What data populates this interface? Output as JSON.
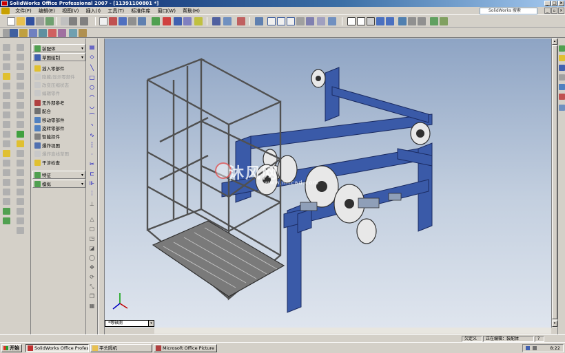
{
  "window": {
    "title": "SolidWorks Office Professional 2007 - [11391100801 *]"
  },
  "menu": {
    "items": [
      "文件(F)",
      "编辑(E)",
      "视图(V)",
      "插入(I)",
      "工具(T)",
      "标准件库",
      "窗口(W)",
      "帮助(H)"
    ],
    "search_label": "SolidWorks 搜索"
  },
  "panel": {
    "items": [
      {
        "label": "装配体",
        "state": "header"
      },
      {
        "label": "草图绘制",
        "state": "header"
      },
      {
        "label": "插入零部件",
        "state": "enabled"
      },
      {
        "label": "隐藏/显示零部件",
        "state": "disabled"
      },
      {
        "label": "改变压缩状态",
        "state": "disabled"
      },
      {
        "label": "编辑零件",
        "state": "disabled"
      },
      {
        "label": "无外部参考",
        "state": "enabled"
      },
      {
        "label": "配合",
        "state": "enabled"
      },
      {
        "label": "移动零部件",
        "state": "enabled"
      },
      {
        "label": "旋转零部件",
        "state": "enabled"
      },
      {
        "label": "智能扣件",
        "state": "enabled"
      },
      {
        "label": "爆炸视图",
        "state": "enabled"
      },
      {
        "label": "爆炸直线草图",
        "state": "disabled"
      },
      {
        "label": "干涉检查",
        "state": "enabled"
      },
      {
        "label": "特征",
        "state": "header"
      },
      {
        "label": "模拟",
        "state": "header"
      }
    ]
  },
  "viewport": {
    "view_name": "*等轴测",
    "watermark_text": "沐风网",
    "watermark_url": "www.mfcad.com",
    "model_color": "#3a5aa8",
    "frame_color": "#6a6a6a"
  },
  "status": {
    "defined_state": "欠定义",
    "editing_label": "正在编辑：装配体"
  },
  "taskbar": {
    "start_label": "开始",
    "tasks": [
      {
        "label": "SolidWorks Office Profes...",
        "active": true
      },
      {
        "label": "平头隔机",
        "active": false
      },
      {
        "label": "Microsoft Office Picture ...",
        "active": false
      }
    ],
    "clock": "8:22"
  }
}
